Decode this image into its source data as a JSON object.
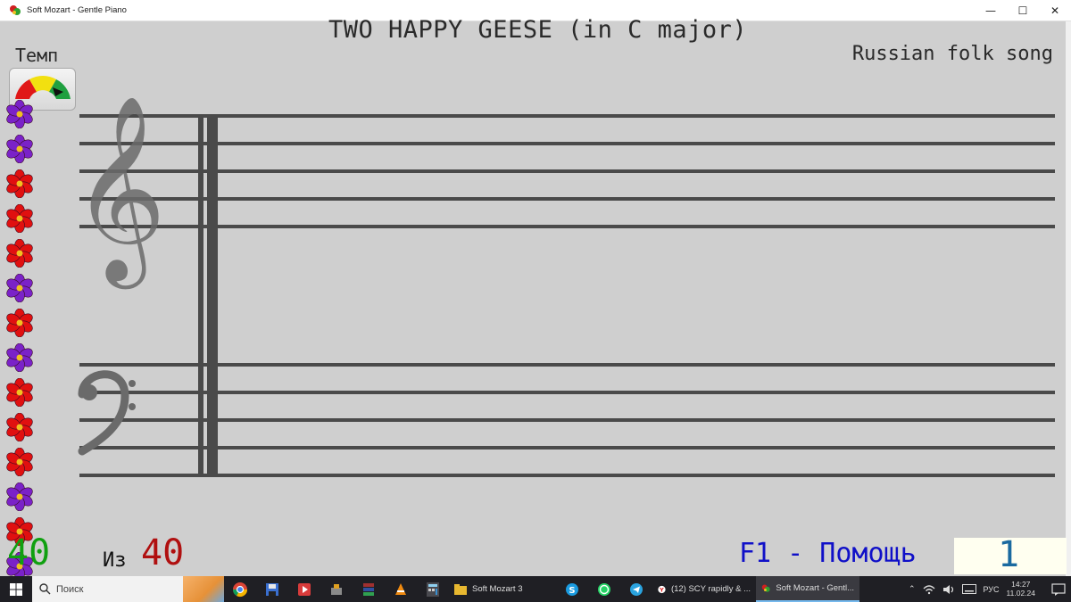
{
  "window": {
    "title": "Soft Mozart - Gentle Piano",
    "minimize_glyph": "—",
    "maximize_glyph": "☐",
    "close_glyph": "✕"
  },
  "song": {
    "title": "TWO HAPPY GEESE (in C major)",
    "author": "Russian folk song"
  },
  "tempo": {
    "label": "Темп"
  },
  "flowers": [
    "purple",
    "purple",
    "red",
    "red",
    "red",
    "purple",
    "red",
    "purple",
    "red",
    "red",
    "red",
    "purple",
    "red",
    "purple"
  ],
  "colors": {
    "red_flower": "#e01010",
    "purple_flower": "#7a22c8",
    "flower_center": "#f0c020"
  },
  "progress": {
    "done": "40",
    "of_label": "Из",
    "total": "40"
  },
  "help": {
    "label": "F1 - Помощь"
  },
  "page": {
    "number": "1"
  },
  "taskbar": {
    "search_placeholder": "Поиск",
    "apps": [
      {
        "label": "Soft Mozart 3",
        "icon": "folder-icon"
      },
      {
        "label": "(12) SCY rapidly & ...",
        "icon": "yandex-browser-icon"
      },
      {
        "label": "Soft Mozart - Gentl...",
        "icon": "soft-mozart-icon"
      }
    ],
    "language": "РУС",
    "time": "14:27",
    "date": "11.02.24"
  }
}
